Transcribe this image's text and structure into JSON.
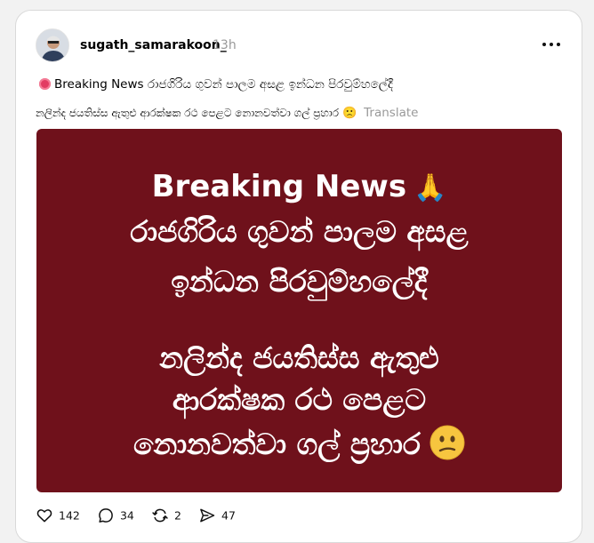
{
  "post": {
    "username": "sugath_samarakoon_",
    "timestamp": "13h",
    "caption_line1": "Breaking News රාජගිරිය ගුවන් පාලම අසළ ඉන්ධන පිරවුම්හලේදී",
    "caption_line2": "නලින්ද ජයතිස්ස ඇතුළු ආරක්ෂක රථ පෙළට නොනවත්වා ගල් ප්‍රහාර",
    "translate_label": "Translate",
    "media_text": {
      "line1": "Breaking News",
      "line2": "රාජගිරිය ගුවන් පාලම අසළ",
      "line3": "ඉන්ධන පිරවුම්හලේදී",
      "line4": "නලින්ද ජයතිස්ස ඇතුළු",
      "line5": "ආරක්ෂක රථ පෙළට",
      "line6": "නොනවත්වා ගල් ප්‍රහාර"
    },
    "icons": {
      "pray": "🙏",
      "small_face": "🙁"
    }
  },
  "actions": {
    "likes": "142",
    "replies": "34",
    "reposts": "2",
    "shares": "47"
  },
  "colors": {
    "media_background": "#6f111b",
    "live_dot": "#e23c63",
    "muted_text": "#999999"
  }
}
